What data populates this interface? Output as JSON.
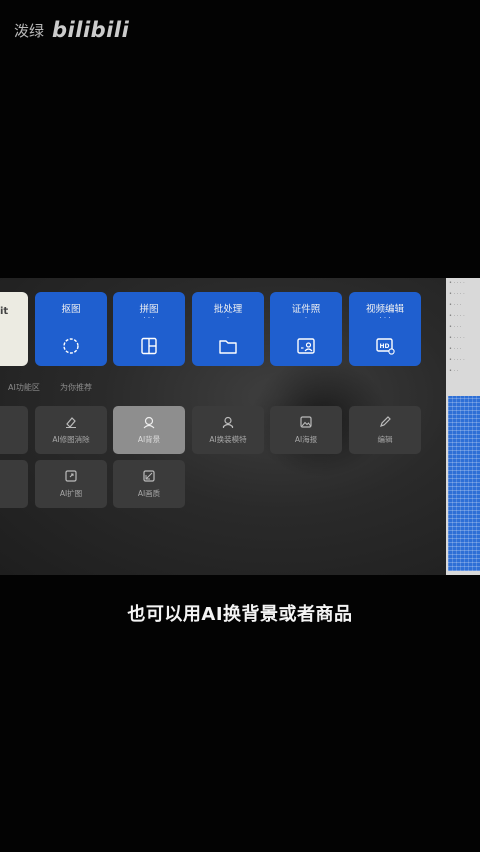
{
  "watermark": {
    "name": "泼绿",
    "logo": "bilibili"
  },
  "left_card": {
    "label": "it"
  },
  "tools": [
    {
      "label": "抠图",
      "dots": "",
      "icon": "circle-dashed-icon"
    },
    {
      "label": "拼图",
      "dots": "· · ·",
      "icon": "collage-icon"
    },
    {
      "label": "批处理",
      "dots": "·",
      "icon": "folder-icon"
    },
    {
      "label": "证件照",
      "dots": "·",
      "icon": "id-photo-icon"
    },
    {
      "label": "视频编辑",
      "dots": "· · ·",
      "icon": "hd-video-icon"
    }
  ],
  "section_hints": [
    "AI功能区",
    "为你推荐"
  ],
  "grid_row1": [
    {
      "label": "…",
      "icon": "generic-icon"
    },
    {
      "label": "AI修图消除",
      "icon": "eraser-icon"
    },
    {
      "label": "AI背景",
      "icon": "ai-background-icon",
      "active": true
    },
    {
      "label": "AI换装模特",
      "icon": "model-icon"
    },
    {
      "label": "AI海报",
      "icon": "image-icon"
    },
    {
      "label": "编辑",
      "icon": "pencil-icon"
    }
  ],
  "grid_row2": [
    {
      "label": "…",
      "icon": "generic-icon"
    },
    {
      "label": "AI扩图",
      "icon": "expand-icon"
    },
    {
      "label": "AI画质",
      "icon": "enhance-icon"
    }
  ],
  "right_strip_lines": [
    "• · · · ·",
    "• · · · ·",
    "• · · ·",
    "• · · · ·",
    "• · · ·",
    "• · · · ·",
    "• · · ·",
    "• · · · ·",
    "• · ·"
  ],
  "subtitle": "也可以用AI换背景或者商品",
  "colors": {
    "tool_blue": "#1f5fcf",
    "background": "#030303",
    "video_panel": "#2a2a2a"
  }
}
